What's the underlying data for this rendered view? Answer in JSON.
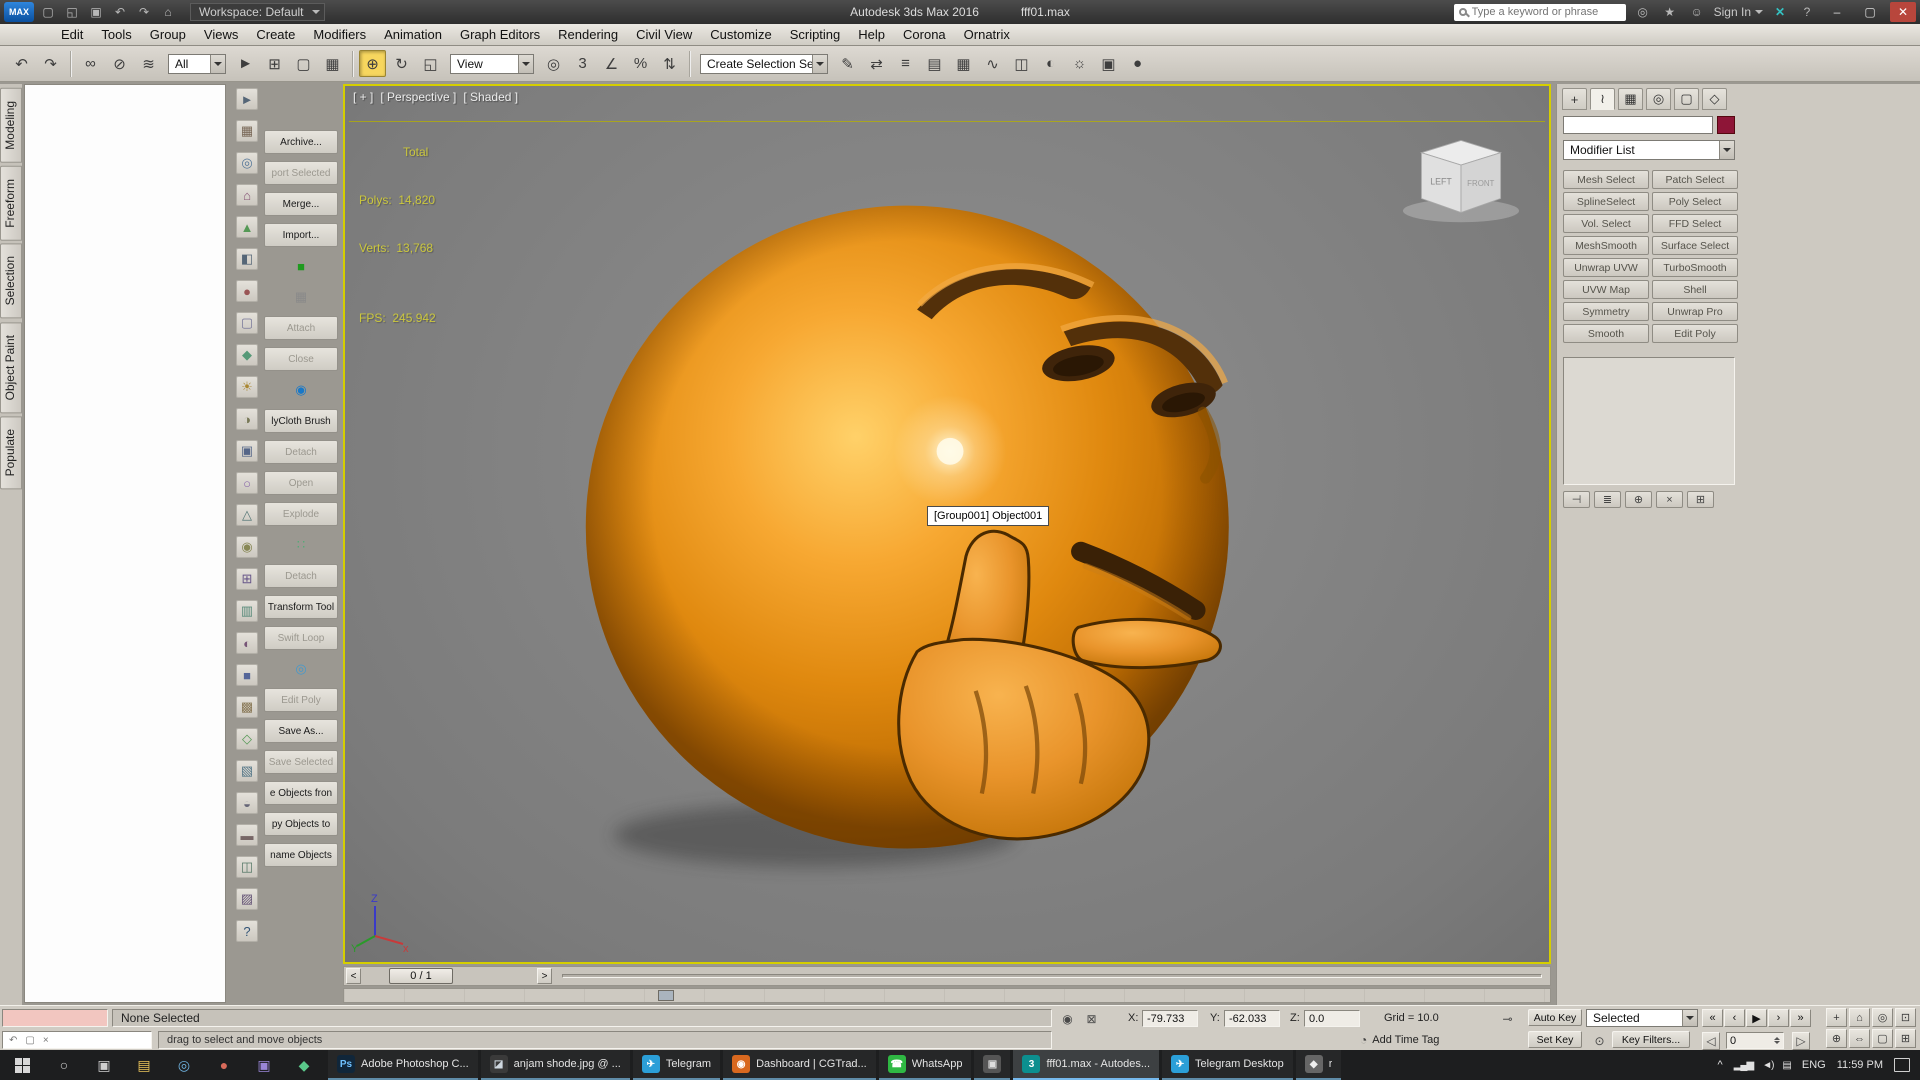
{
  "colors": {
    "viewport_border": "#d5ce00",
    "emoji_orange": "#e8920f",
    "ui_gray": "#cdc9c1",
    "taskbar_bg": "#1d1e1f",
    "stats_yellow": "#cbc73d",
    "active_tool": "#f7d65e",
    "object_color_swatch": "#8e1537"
  },
  "titlebar": {
    "logo": "MAX",
    "quick_icons": [
      {
        "glyph": "▢",
        "name": "new-scene-icon"
      },
      {
        "glyph": "◱",
        "name": "open-file-icon"
      },
      {
        "glyph": "▣",
        "name": "save-file-icon"
      },
      {
        "glyph": "↶",
        "name": "undo-icon"
      },
      {
        "glyph": "↷",
        "name": "redo-icon"
      },
      {
        "glyph": "⌂",
        "name": "project-folder-icon"
      }
    ],
    "workspace": "Workspace: Default",
    "app_title": "Autodesk 3ds Max 2016",
    "file_name": "fff01.max",
    "search_placeholder": "Type a keyword or phrase",
    "right_icons": [
      {
        "glyph": "◎",
        "name": "communication-center-icon"
      },
      {
        "glyph": "★",
        "name": "favorites-icon"
      },
      {
        "glyph": "☺",
        "name": "user-account-icon"
      }
    ],
    "sign_in": "Sign In",
    "x_icon": "✕",
    "help_icon": "?",
    "win": {
      "minimize": "–",
      "maximize": "▢",
      "close": "✕"
    }
  },
  "menu": {
    "items": [
      "Edit",
      "Tools",
      "Group",
      "Views",
      "Create",
      "Modifiers",
      "Animation",
      "Graph Editors",
      "Rendering",
      "Civil View",
      "Customize",
      "Scripting",
      "Help",
      "Corona",
      "Ornatrix"
    ]
  },
  "toolbar": {
    "group1": [
      {
        "glyph": "↶",
        "name": "undo-icon"
      },
      {
        "glyph": "↷",
        "name": "redo-icon"
      }
    ],
    "group2": [
      {
        "glyph": "∞",
        "name": "select-and-link-icon"
      },
      {
        "glyph": "⊘",
        "name": "unlink-selection-icon"
      },
      {
        "glyph": "≋",
        "name": "bind-to-space-warp-icon"
      }
    ],
    "selection_filter": "All",
    "group3": [
      {
        "glyph": "►",
        "name": "select-object-icon"
      },
      {
        "glyph": "⊞",
        "name": "select-by-name-icon"
      },
      {
        "glyph": "▢",
        "name": "selection-region-icon"
      },
      {
        "glyph": "▦",
        "name": "window-crossing-icon"
      }
    ],
    "group4": [
      {
        "glyph": "⊕",
        "name": "select-and-move-icon",
        "active": true
      },
      {
        "glyph": "↻",
        "name": "select-and-rotate-icon"
      },
      {
        "glyph": "◱",
        "name": "select-and-scale-icon"
      }
    ],
    "ref_coord": "View",
    "group5": [
      {
        "glyph": "◎",
        "name": "use-pivot-center-icon"
      },
      {
        "glyph": "3",
        "name": "snaps-toggle-icon"
      },
      {
        "glyph": "∠",
        "name": "angle-snap-icon"
      },
      {
        "glyph": "%",
        "name": "percent-snap-icon"
      },
      {
        "glyph": "⇅",
        "name": "spinner-snap-icon"
      }
    ],
    "named_selection": "Create Selection Se",
    "group6": [
      {
        "glyph": "✎",
        "name": "edit-named-selections-icon"
      },
      {
        "glyph": "⇄",
        "name": "mirror-icon"
      },
      {
        "glyph": "≡",
        "name": "align-icon"
      },
      {
        "glyph": "▤",
        "name": "layer-manager-icon"
      },
      {
        "glyph": "▦",
        "name": "ribbon-toggle-icon"
      },
      {
        "glyph": "∿",
        "name": "curve-editor-icon"
      },
      {
        "glyph": "◫",
        "name": "schematic-view-icon"
      },
      {
        "glyph": "◐",
        "name": "material-editor-icon"
      },
      {
        "glyph": "☼",
        "name": "render-setup-icon"
      },
      {
        "glyph": "▣",
        "name": "rendered-frame-window-icon"
      },
      {
        "glyph": "●",
        "name": "render-production-icon"
      }
    ]
  },
  "ribbon": {
    "tabs": [
      "Modeling",
      "Freeform",
      "Selection",
      "Object Paint",
      "Populate"
    ]
  },
  "left_icons": [
    {
      "glyph": "►",
      "color": "#556677"
    },
    {
      "glyph": "▦",
      "color": "#776655"
    },
    {
      "glyph": "◎",
      "color": "#557799"
    },
    {
      "glyph": "⌂",
      "color": "#885577"
    },
    {
      "glyph": "▲",
      "color": "#559955"
    },
    {
      "glyph": "◧",
      "color": "#556677"
    },
    {
      "glyph": "●",
      "color": "#995555"
    },
    {
      "glyph": "▢",
      "color": "#777799"
    },
    {
      "glyph": "◆",
      "color": "#559977"
    },
    {
      "glyph": "☀",
      "color": "#aa8833"
    },
    {
      "glyph": "◑",
      "color": "#777755"
    },
    {
      "glyph": "▣",
      "color": "#556688"
    },
    {
      "glyph": "○",
      "color": "#8866aa"
    },
    {
      "glyph": "△",
      "color": "#557777"
    },
    {
      "glyph": "◉",
      "color": "#888855"
    },
    {
      "glyph": "⊞",
      "color": "#665588"
    },
    {
      "glyph": "▥",
      "color": "#558877"
    },
    {
      "glyph": "◐",
      "color": "#775577"
    },
    {
      "glyph": "■",
      "color": "#556699"
    },
    {
      "glyph": "▩",
      "color": "#887755"
    },
    {
      "glyph": "◇",
      "color": "#559955"
    },
    {
      "glyph": "▧",
      "color": "#557788"
    },
    {
      "glyph": "◒",
      "color": "#666677"
    },
    {
      "glyph": "▬",
      "color": "#776666"
    },
    {
      "glyph": "◫",
      "color": "#557766"
    },
    {
      "glyph": "▨",
      "color": "#665577"
    },
    {
      "glyph": "?",
      "color": "#335577"
    }
  ],
  "left_tools": [
    {
      "kind": "text",
      "label": "Archive...",
      "enabled": true
    },
    {
      "kind": "text",
      "label": "port Selected",
      "enabled": false
    },
    {
      "kind": "text",
      "label": "Merge...",
      "enabled": true
    },
    {
      "kind": "text",
      "label": "Import...",
      "enabled": true
    },
    {
      "kind": "icon",
      "glyph": "■",
      "color": "#1f9a1f",
      "enabled": true
    },
    {
      "kind": "icon",
      "glyph": "▦",
      "color": "#8a8a8a",
      "enabled": false
    },
    {
      "kind": "text",
      "label": "Attach",
      "enabled": false
    },
    {
      "kind": "text",
      "label": "Close",
      "enabled": false
    },
    {
      "kind": "icon",
      "glyph": "◉",
      "color": "#1878c8",
      "enabled": true
    },
    {
      "kind": "text",
      "label": "lyCloth Brush",
      "enabled": true
    },
    {
      "kind": "text",
      "label": "Detach",
      "enabled": false
    },
    {
      "kind": "text",
      "label": "Open",
      "enabled": false
    },
    {
      "kind": "text",
      "label": "Explode",
      "enabled": false
    },
    {
      "kind": "icon",
      "glyph": "∷",
      "color": "#55aa77",
      "enabled": true
    },
    {
      "kind": "text",
      "label": "Detach",
      "enabled": false
    },
    {
      "kind": "text",
      "label": "Transform Tool",
      "enabled": true
    },
    {
      "kind": "text",
      "label": "Swift Loop",
      "enabled": false
    },
    {
      "kind": "icon",
      "glyph": "◎",
      "color": "#4499cc",
      "enabled": true
    },
    {
      "kind": "text",
      "label": "Edit Poly",
      "enabled": false
    },
    {
      "kind": "text",
      "label": "Save As...",
      "enabled": true
    },
    {
      "kind": "text",
      "label": "Save Selected",
      "enabled": false
    },
    {
      "kind": "text",
      "label": "e Objects fron",
      "enabled": true
    },
    {
      "kind": "text",
      "label": "py Objects to",
      "enabled": true
    },
    {
      "kind": "text",
      "label": "name Objects",
      "enabled": true
    }
  ],
  "viewport": {
    "label": {
      "plus": "[ + ]",
      "pov": "[ Perspective ]",
      "shading": "[ Shaded ]"
    },
    "stats": {
      "total": "Total",
      "polys": "Polys:  14,820",
      "verts": "Verts:  13,768",
      "fps": "FPS:  245.942"
    },
    "tooltip": "[Group001] Object001",
    "viewcube": {
      "left_face": "LEFT",
      "front_face": "FRONT"
    },
    "axis": {
      "x": "x",
      "y": "Y",
      "z": "Z"
    }
  },
  "timeline": {
    "prev": "<",
    "slider_label": "0 / 1",
    "next": ">"
  },
  "status": {
    "selection": "None Selected",
    "prompt": "drag to select and move objects",
    "listener_icons": [
      "↶",
      "▢",
      "×"
    ],
    "isolate_icon": "◉",
    "lock_icon": "⊠",
    "coords": {
      "x_label": "X:",
      "x": "-79.733",
      "y_label": "Y:",
      "y": "-62.033",
      "z_label": "Z:",
      "z": "0.0"
    },
    "grid": "Grid = 10.0",
    "key_icon": "⊸",
    "auto_key": "Auto Key",
    "set_key": "Set Key",
    "selected_set": "Selected",
    "key_filters": "Key Filters...",
    "add_time_tag": "Add Time Tag",
    "frame": "0",
    "playback": [
      "«",
      "‹",
      "▶",
      "›",
      "»"
    ],
    "nav_icons": [
      "+",
      "⌂",
      "◎",
      "⊡",
      "⊕",
      "⇔",
      "▢",
      "⊞"
    ]
  },
  "command_panel": {
    "tabs": [
      {
        "glyph": "+",
        "name": "create-tab"
      },
      {
        "glyph": "≀",
        "name": "modify-tab",
        "active": true
      },
      {
        "glyph": "▦",
        "name": "hierarchy-tab"
      },
      {
        "glyph": "◎",
        "name": "motion-tab"
      },
      {
        "glyph": "▢",
        "name": "display-tab"
      },
      {
        "glyph": "◇",
        "name": "utilities-tab"
      }
    ],
    "modifier_list_label": "Modifier List",
    "modifier_buttons": [
      {
        "label": "Mesh Select"
      },
      {
        "label": "Patch Select"
      },
      {
        "label": "SplineSelect"
      },
      {
        "label": "Poly Select"
      },
      {
        "label": "Vol. Select"
      },
      {
        "label": "FFD Select"
      },
      {
        "label": "MeshSmooth"
      },
      {
        "label": "Surface Select"
      },
      {
        "label": "Unwrap UVW"
      },
      {
        "label": "TurboSmooth"
      },
      {
        "label": "UVW Map"
      },
      {
        "label": "Shell"
      },
      {
        "label": "Symmetry"
      },
      {
        "label": "Unwrap Pro"
      },
      {
        "label": "Smooth"
      },
      {
        "label": "Edit Poly"
      }
    ],
    "stack_tools": [
      {
        "glyph": "⊣"
      },
      {
        "glyph": "≣"
      },
      {
        "glyph": "⊕"
      },
      {
        "glyph": "×"
      },
      {
        "glyph": "⊞"
      }
    ]
  },
  "taskbar": {
    "pinned": [
      {
        "glyph": "▤",
        "color": "#e8c35a"
      },
      {
        "glyph": "◎",
        "color": "#6fb3e0"
      },
      {
        "glyph": "●",
        "color": "#d86a5a"
      },
      {
        "glyph": "▣",
        "color": "#9a86d8"
      },
      {
        "glyph": "◆",
        "color": "#5ac88a"
      }
    ],
    "apps": [
      {
        "name": "taskbar-app-photoshop",
        "label": "Adobe Photoshop C...",
        "icon_text": "Ps",
        "icon_bg": "#10263a",
        "icon_fg": "#6fc1ff"
      },
      {
        "name": "taskbar-app-image",
        "label": "anjam shode.jpg @ ...",
        "icon_text": "◪",
        "icon_bg": "#3a3a3a",
        "icon_fg": "#cfd8e0"
      },
      {
        "name": "taskbar-app-telegram",
        "label": "Telegram",
        "icon_text": "✈",
        "icon_bg": "#2b9fd8",
        "icon_fg": "#ffffff"
      },
      {
        "name": "taskbar-app-browser",
        "label": "Dashboard | CGTrad...",
        "icon_text": "◉",
        "icon_bg": "#d8681f",
        "icon_fg": "#ffffff"
      },
      {
        "name": "taskbar-app-whatsapp",
        "label": "WhatsApp",
        "icon_text": "☎",
        "icon_bg": "#2fb843",
        "icon_fg": "#ffffff"
      },
      {
        "name": "taskbar-app-untitled",
        "label": "",
        "icon_text": "▣",
        "icon_bg": "#555555",
        "icon_fg": "#dddddd"
      },
      {
        "name": "taskbar-app-3dsmax",
        "label": "fff01.max - Autodes...",
        "icon_text": "3",
        "icon_bg": "#0c8f8f",
        "icon_fg": "#ffffff",
        "active": true
      },
      {
        "name": "taskbar-app-telegram-desktop",
        "label": "Telegram Desktop",
        "icon_text": "✈",
        "icon_bg": "#2b9fd8",
        "icon_fg": "#ffffff"
      },
      {
        "name": "taskbar-app-r",
        "label": "r",
        "icon_text": "◆",
        "icon_bg": "#666666",
        "icon_fg": "#eeeeee"
      }
    ],
    "tray": {
      "chevron": "^",
      "icons": [
        {
          "glyph": "▂▄▆",
          "name": "network-icon"
        },
        {
          "glyph": "◄)",
          "name": "volume-icon"
        },
        {
          "glyph": "▤",
          "name": "tray-app-icon"
        }
      ],
      "lang": "ENG",
      "time": "11:59 PM"
    }
  }
}
